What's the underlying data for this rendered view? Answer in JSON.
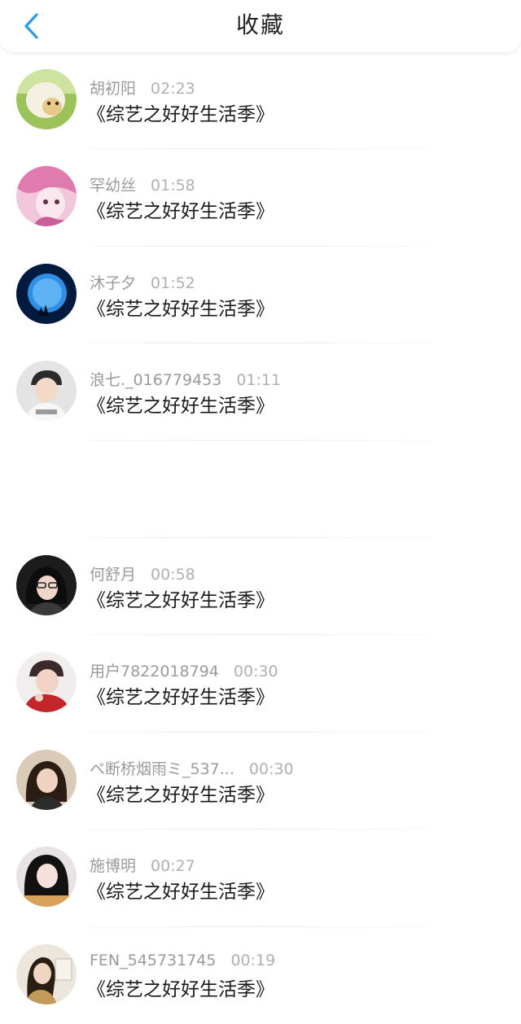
{
  "header": {
    "title": "收藏"
  },
  "items": [
    {
      "name": "胡初阳",
      "time": "02:23",
      "content": "《综艺之好好生活季》",
      "avatar_color": "#8bb04a"
    },
    {
      "name": "罕幼丝",
      "time": "01:58",
      "content": "《综艺之好好生活季》",
      "avatar_color": "#e9a7c9"
    },
    {
      "name": "沐子夕",
      "time": "01:52",
      "content": "《综艺之好好生活季》",
      "avatar_color": "#0a3a7a"
    },
    {
      "name": "浪七._016779453",
      "time": "01:11",
      "content": "《综艺之好好生活季》",
      "avatar_color": "#c9c9c9"
    },
    {
      "name": "",
      "time": "",
      "content": "",
      "avatar_color": ""
    },
    {
      "name": "何舒月",
      "time": "00:58",
      "content": "《综艺之好好生活季》",
      "avatar_color": "#2a2a2a"
    },
    {
      "name": "用户7822018794",
      "time": "00:30",
      "content": "《综艺之好好生活季》",
      "avatar_color": "#b02a2a"
    },
    {
      "name": "ベ断桥烟雨ミ_537...",
      "time": "00:30",
      "content": "《综艺之好好生活季》",
      "avatar_color": "#5a4632"
    },
    {
      "name": "施博明",
      "time": "00:27",
      "content": "《综艺之好好生活季》",
      "avatar_color": "#1f1f1f"
    },
    {
      "name": "FEN_545731745",
      "time": "00:19",
      "content": "《综艺之好好生活季》",
      "avatar_color": "#8a6a40"
    }
  ]
}
